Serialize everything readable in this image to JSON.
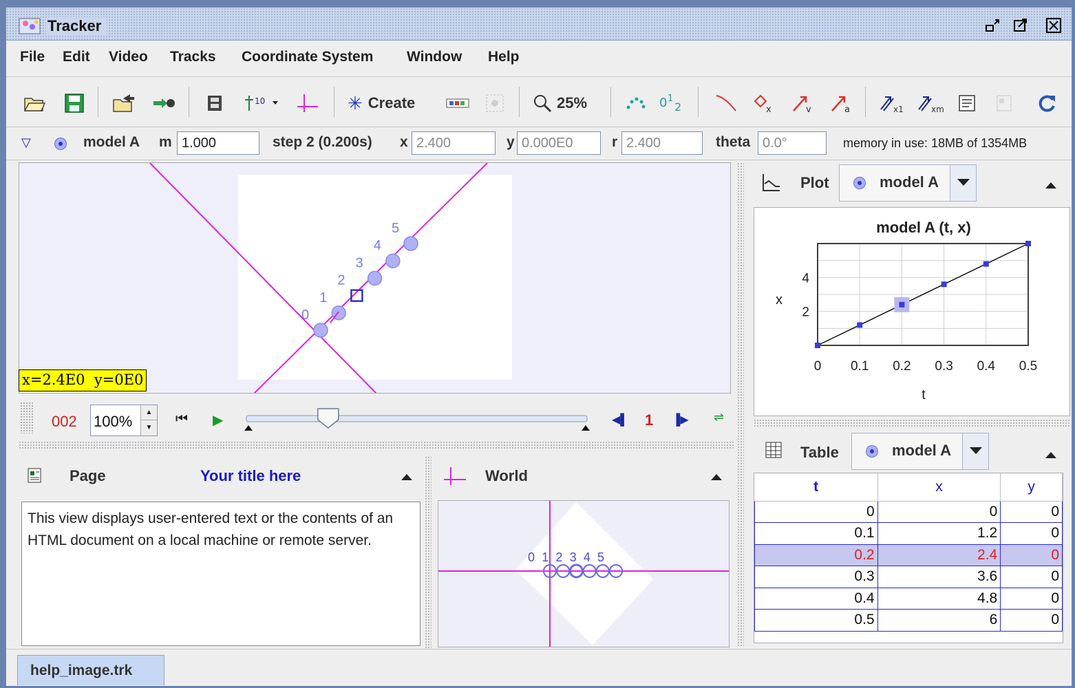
{
  "window": {
    "title": "Tracker"
  },
  "menu": [
    "File",
    "Edit",
    "Video",
    "Tracks",
    "Coordinate System",
    "Window",
    "Help"
  ],
  "toolbar": {
    "create_label": "Create",
    "zoom_label": "25%"
  },
  "trackbar": {
    "track_name": "model A",
    "m_label": "m",
    "m_value": "1.000",
    "step_label": "step 2 (0.200s)",
    "x_label": "x",
    "x_value": "2.400",
    "y_label": "y",
    "y_value": "0.000E0",
    "r_label": "r",
    "r_value": "2.400",
    "theta_label": "theta",
    "theta_value": "0.0°",
    "memory": "memory in use: 18MB of 1354MB"
  },
  "video": {
    "readout": "x=2.4E0  y=0E0",
    "step_labels": [
      "0",
      "1",
      "2",
      "3",
      "4",
      "5"
    ]
  },
  "player": {
    "frame": "002",
    "rate": "100%",
    "step_size": "1",
    "slider_fraction": 0.24
  },
  "page_panel": {
    "title": "Page",
    "heading": "Your title here",
    "text": "This view displays user-entered text or the contents of an HTML document on a local machine or remote server."
  },
  "world_panel": {
    "title": "World",
    "labels": [
      "0",
      "1",
      "2",
      "3",
      "4",
      "5"
    ]
  },
  "plot_panel": {
    "title": "Plot",
    "track": "model A",
    "chart_title": "model A (t, x)",
    "xlabel": "t",
    "ylabel": "x",
    "x_ticks": [
      "0",
      "0.1",
      "0.2",
      "0.3",
      "0.4",
      "0.5"
    ],
    "y_ticks": [
      "2",
      "4"
    ]
  },
  "chart_data": {
    "type": "line",
    "title": "model A (t, x)",
    "xlabel": "t",
    "ylabel": "x",
    "x": [
      0,
      0.1,
      0.2,
      0.3,
      0.4,
      0.5
    ],
    "y": [
      0,
      1.2,
      2.4,
      3.6,
      4.8,
      6
    ],
    "xlim": [
      0,
      0.5
    ],
    "ylim": [
      0,
      6
    ],
    "grid": true,
    "selected_index": 2
  },
  "table_panel": {
    "title": "Table",
    "track": "model A",
    "columns": [
      "t",
      "x",
      "y"
    ],
    "rows": [
      [
        "0",
        "0",
        "0"
      ],
      [
        "0.1",
        "1.2",
        "0"
      ],
      [
        "0.2",
        "2.4",
        "0"
      ],
      [
        "0.3",
        "3.6",
        "0"
      ],
      [
        "0.4",
        "4.8",
        "0"
      ],
      [
        "0.5",
        "6",
        "0"
      ]
    ],
    "selected_row": 2
  },
  "tabs": [
    "help_image.trk"
  ],
  "colors": {
    "track": "#7b7bf0",
    "axes": "#e020e0",
    "selected": "#e02020",
    "header_blue": "#1a1ac8"
  }
}
